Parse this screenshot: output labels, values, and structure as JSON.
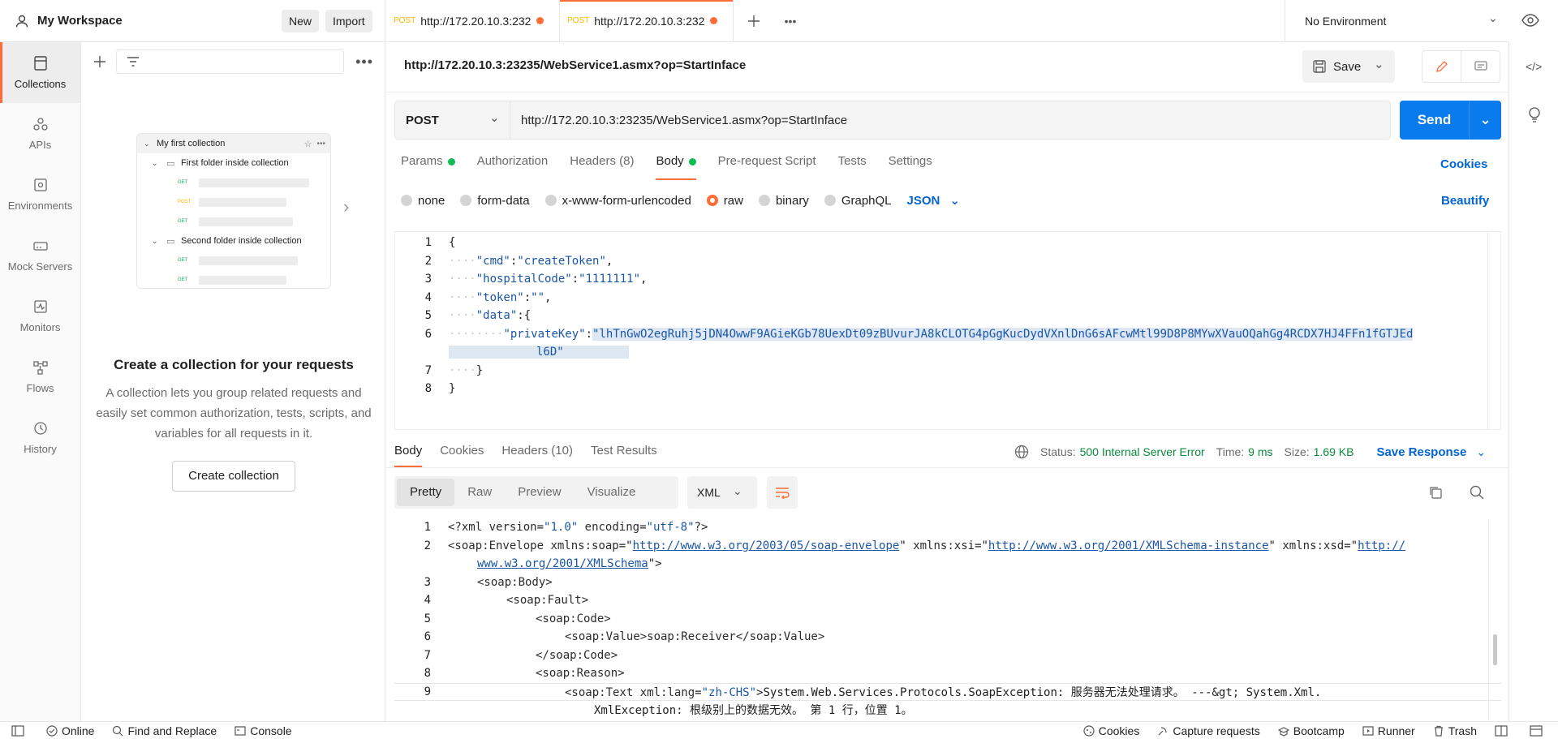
{
  "workspace": {
    "title": "My Workspace",
    "new_label": "New",
    "import_label": "Import"
  },
  "rail": [
    {
      "label": "Collections",
      "icon": "collections-icon",
      "active": true
    },
    {
      "label": "APIs",
      "icon": "apis-icon"
    },
    {
      "label": "Environments",
      "icon": "environments-icon"
    },
    {
      "label": "Mock Servers",
      "icon": "mock-servers-icon"
    },
    {
      "label": "Monitors",
      "icon": "monitors-icon"
    },
    {
      "label": "Flows",
      "icon": "flows-icon"
    },
    {
      "label": "History",
      "icon": "history-icon"
    }
  ],
  "sidebar": {
    "preview": {
      "collection": "My first collection",
      "folder1": "First folder inside collection",
      "folder2": "Second folder inside collection",
      "get": "GET",
      "post": "POST"
    },
    "empty_title": "Create a collection for your requests",
    "empty_desc": "A collection lets you group related requests and easily set common authorization, tests, scripts, and variables for all requests in it.",
    "create_label": "Create collection"
  },
  "tabs": [
    {
      "method": "POST",
      "label": "http://172.20.10.3:232"
    },
    {
      "method": "POST",
      "label": "http://172.20.10.3:232"
    }
  ],
  "environment": "No Environment",
  "request": {
    "title": "http://172.20.10.3:23235/WebService1.asmx?op=StartInface",
    "save_label": "Save",
    "method": "POST",
    "url": "http://172.20.10.3:23235/WebService1.asmx?op=StartInface",
    "send_label": "Send",
    "subtabs": {
      "params": "Params",
      "authorization": "Authorization",
      "headers": "Headers",
      "headers_count": "(8)",
      "body": "Body",
      "prerequest": "Pre-request Script",
      "tests": "Tests",
      "settings": "Settings"
    },
    "cookies_label": "Cookies",
    "body_types": {
      "none": "none",
      "form_data": "form-data",
      "urlencoded": "x-www-form-urlencoded",
      "raw": "raw",
      "binary": "binary",
      "graphql": "GraphQL",
      "json": "JSON"
    },
    "beautify_label": "Beautify",
    "body_lines": {
      "n1": "1",
      "n2": "2",
      "n3": "3",
      "n4": "4",
      "n5": "5",
      "n6": "6",
      "n7": "7",
      "n8": "8",
      "cmd_key": "\"cmd\"",
      "cmd_val": "\"createToken\"",
      "hosp_key": "\"hospitalCode\"",
      "hosp_val": "\"1111111\"",
      "token_key": "\"token\"",
      "token_val": "\"\"",
      "data_key": "\"data\"",
      "pk_key": "\"privateKey\"",
      "pk_val1": "\"lhTnGwO2egRuhj5jDN4OwwF9AGieKGb78UexDt09zBUvurJA8kCLOTG4pGgKucDydVXnlDnG6sAFcwMtl99D8P8MYwXVauOQahGg4RCDX7HJ4FFn1fGTJEd",
      "pk_val2": "l6D\""
    }
  },
  "response": {
    "tabs": {
      "body": "Body",
      "cookies": "Cookies",
      "headers": "Headers",
      "headers_count": "(10)",
      "tests": "Test Results"
    },
    "status_label": "Status:",
    "status_value": "500 Internal Server Error",
    "time_label": "Time:",
    "time_value": "9 ms",
    "size_label": "Size:",
    "size_value": "1.69 KB",
    "save_response": "Save Response",
    "formats": {
      "pretty": "Pretty",
      "raw": "Raw",
      "preview": "Preview",
      "visualize": "Visualize"
    },
    "language": "XML",
    "lines": {
      "n1": "1",
      "n2": "2",
      "n3": "3",
      "n4": "4",
      "n5": "5",
      "n6": "6",
      "n7": "7",
      "n8": "8",
      "n9": "9",
      "l1_tag": "<?xml",
      "l1_a1": "version",
      "l1_v1": "\"1.0\"",
      "l1_a2": "encoding",
      "l1_v2": "\"utf-8\"",
      "l1_end": "?>",
      "l2_tag": "<soap:Envelope",
      "l2_a1": "xmlns:soap",
      "l2_v1": "http://www.w3.org/2003/05/soap-envelope",
      "l2_a2": "xmlns:xsi",
      "l2_v2": "http://www.w3.org/2001/XMLSchema-instance",
      "l2_a3": "xmlns:xsd",
      "l2_v3a": "http://",
      "l2_v3b": "www.w3.org/2001/XMLSchema",
      "l3": "<soap:Body>",
      "l4": "<soap:Fault>",
      "l5": "<soap:Code>",
      "l6": "<soap:Value>soap:Receiver</soap:Value>",
      "l7": "</soap:Code>",
      "l8": "<soap:Reason>",
      "l9_tag": "<soap:Text",
      "l9_attr": "xml:lang",
      "l9_val": "\"zh-CHS\"",
      "l9_text": ">System.Web.Services.Protocols.SoapException: 服务器无法处理请求。 ---&gt; System.Xml.",
      "l9_text2": "XmlException: 根级别上的数据无效。 第 1 行，位置 1。"
    }
  },
  "statusbar": {
    "online": "Online",
    "find_replace": "Find and Replace",
    "console": "Console",
    "cookies": "Cookies",
    "capture": "Capture requests",
    "bootcamp": "Bootcamp",
    "runner": "Runner",
    "trash": "Trash"
  }
}
